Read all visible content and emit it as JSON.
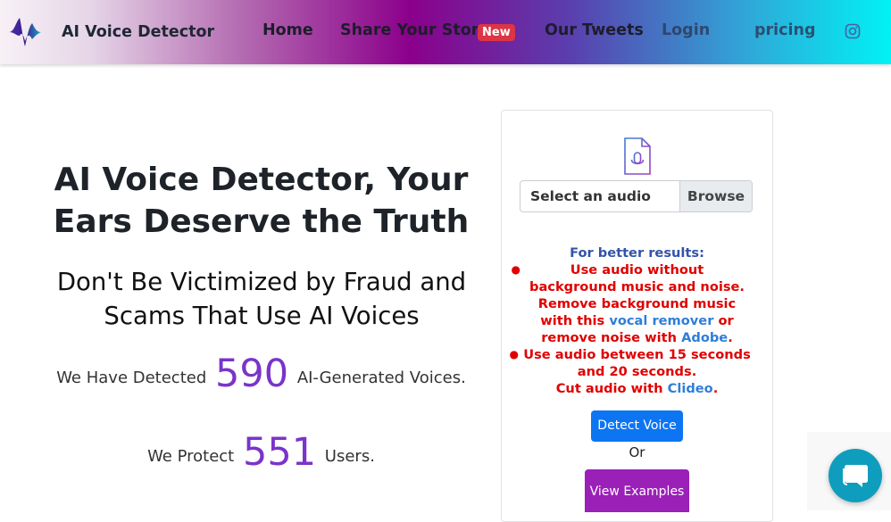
{
  "nav": {
    "brand": "AI Voice Detector",
    "links": [
      {
        "label": "Home"
      },
      {
        "label": "Share Your Story",
        "badge": "New"
      },
      {
        "label": "Our Tweets"
      },
      {
        "label": "Login"
      },
      {
        "label": "pricing"
      }
    ],
    "icons": {
      "logo": "waveform-logo-icon",
      "social": "instagram-icon"
    }
  },
  "hero": {
    "title_part1": "AI Voice Detector",
    "title_part2": ", Your Ears Deserve the Truth",
    "subtitle": "Don't Be Victimized by Fraud and Scams That Use AI Voices",
    "stat1_prefix": "We Have Detected",
    "stat1_value": "590",
    "stat1_suffix": "AI-Generated Voices.",
    "stat2_prefix": "We Protect",
    "stat2_value": "551",
    "stat2_suffix": "Users."
  },
  "upload": {
    "file_icon": "audio-file-icon",
    "file_placeholder": "Select an audio file",
    "browse_label": "Browse",
    "tips_heading": "For better results:",
    "tip1": "Use audio without background music and noise.",
    "tip1b_pre": "Remove background music with this",
    "tip1b_link1": "vocal remover",
    "tip1b_mid": "or remove noise with",
    "tip1b_link2": "Adobe",
    "tip1b_end": ".",
    "tip2": "Use audio between 15 seconds and 20 seconds.",
    "tip2b_pre": "Cut audio with",
    "tip2b_link": "Clideo",
    "tip2b_end": ".",
    "detect_label": "Detect Voice",
    "or_text": "Or",
    "examples_label": "View Examples"
  },
  "colors": {
    "accent_purple": "#7a34c9",
    "detect_blue": "#0d75f2",
    "examples_purple": "#9a20b8",
    "tip_red": "#e00000",
    "link_blue": "#2f7ed8",
    "chat_teal": "#0e9dbd"
  },
  "chat": {
    "icon": "chat-bubble-icon"
  }
}
